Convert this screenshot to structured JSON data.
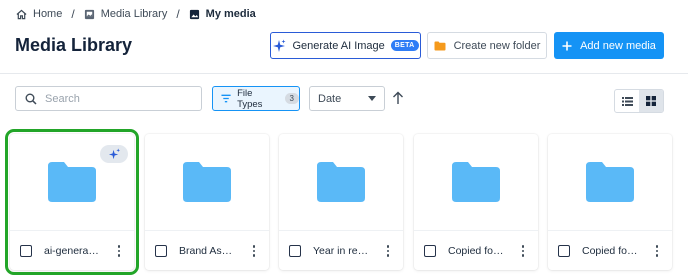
{
  "breadcrumb": {
    "items": [
      {
        "label": "Home",
        "icon": "home-icon"
      },
      {
        "label": "Media Library",
        "icon": "media-library-icon"
      },
      {
        "label": "My media",
        "icon": "image-icon"
      }
    ],
    "separator": "/"
  },
  "page": {
    "title": "Media Library"
  },
  "header_actions": {
    "generate_ai_label": "Generate AI Image",
    "beta_badge": "BETA",
    "create_folder_label": "Create new folder",
    "add_media_label": "Add new media"
  },
  "toolbar": {
    "search_placeholder": "Search",
    "filter_label": "File Types",
    "filter_count": "3",
    "sort_value": "Date"
  },
  "folders": [
    {
      "name": "ai-generated",
      "selected": true,
      "ai": true
    },
    {
      "name": "Brand Assets",
      "selected": false,
      "ai": false
    },
    {
      "name": "Year in review",
      "selected": false,
      "ai": false
    },
    {
      "name": "Copied folder",
      "selected": false,
      "ai": false
    },
    {
      "name": "Copied folder",
      "selected": false,
      "ai": false
    }
  ],
  "colors": {
    "primary": "#1593f5",
    "folder": "#5ab9f7",
    "selection": "#22a528",
    "ai_border": "#2a5bd7",
    "folder_button_icon": "#f59a1c"
  }
}
